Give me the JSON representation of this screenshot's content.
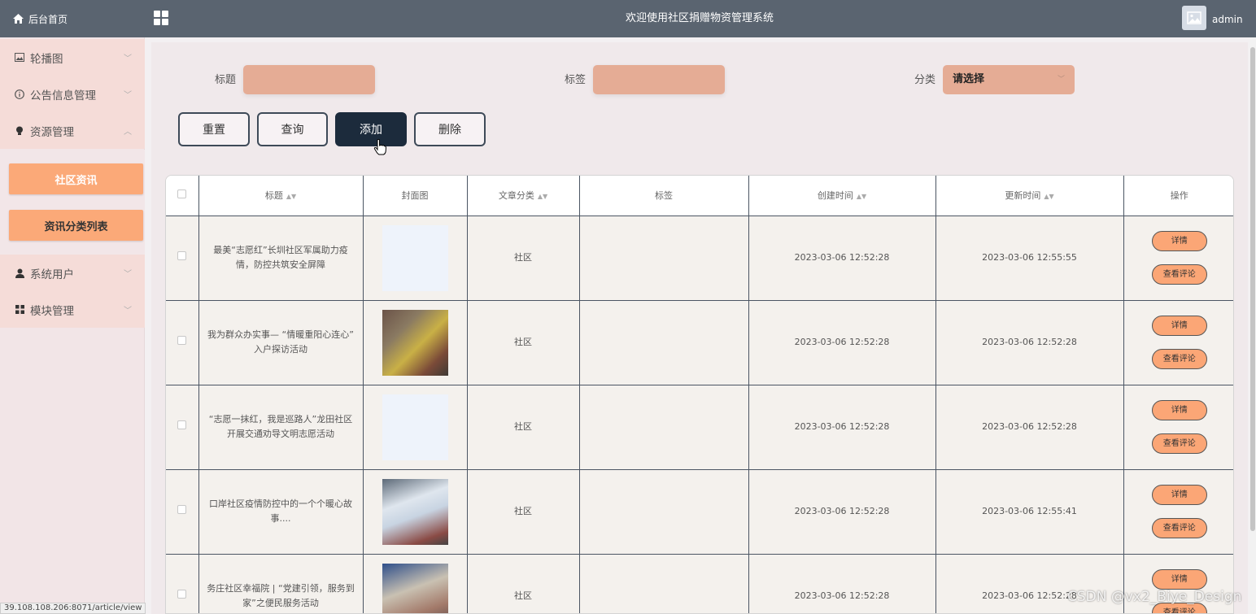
{
  "header": {
    "home_label": "后台首页",
    "title": "欢迎使用社区捐赠物资管理系统",
    "username": "admin"
  },
  "sidebar": {
    "items": [
      {
        "label": "轮播图",
        "icon": "image-icon"
      },
      {
        "label": "公告信息管理",
        "icon": "info-circle-icon"
      },
      {
        "label": "资源管理",
        "icon": "bulb-icon"
      },
      {
        "label": "系统用户",
        "icon": "user-icon"
      },
      {
        "label": "模块管理",
        "icon": "modules-icon"
      }
    ],
    "subitems": [
      {
        "label": "社区资讯"
      },
      {
        "label": "资讯分类列表"
      }
    ]
  },
  "filters": {
    "title_label": "标题",
    "title_value": "",
    "tag_label": "标签",
    "tag_value": "",
    "category_label": "分类",
    "category_value": "请选择"
  },
  "actions": {
    "reset": "重置",
    "query": "查询",
    "add": "添加",
    "delete": "删除"
  },
  "table": {
    "columns": [
      "标题",
      "封面图",
      "文章分类",
      "标签",
      "创建时间",
      "更新时间",
      "操作"
    ],
    "rows": [
      {
        "title": "最美“志愿红”长圳社区军属助力疫情，防控共筑安全屏障",
        "category": "社区",
        "tag": "",
        "created": "2023-03-06 12:52:28",
        "updated": "2023-03-06 12:55:55"
      },
      {
        "title": "我为群众办实事— “情暖重阳心连心” 入户探访活动",
        "category": "社区",
        "tag": "",
        "created": "2023-03-06 12:52:28",
        "updated": "2023-03-06 12:52:28"
      },
      {
        "title": "“志愿一抹红，我是巡路人”龙田社区开展交通劝导文明志愿活动",
        "category": "社区",
        "tag": "",
        "created": "2023-03-06 12:52:28",
        "updated": "2023-03-06 12:52:28"
      },
      {
        "title": "口岸社区疫情防控中的一个个暖心故事....",
        "category": "社区",
        "tag": "",
        "created": "2023-03-06 12:52:28",
        "updated": "2023-03-06 12:55:41"
      },
      {
        "title": "务庄社区幸福院 | “党建引领，服务到家”之便民服务活动",
        "category": "社区",
        "tag": "",
        "created": "2023-03-06 12:52:28",
        "updated": "2023-03-06 12:52:28"
      }
    ],
    "detail_label": "详情",
    "comments_label": "查看评论"
  },
  "statusbar": {
    "url": "39.108.108.206:8071/article/view"
  },
  "watermark": "CSDN @vx2_Biye_Design"
}
